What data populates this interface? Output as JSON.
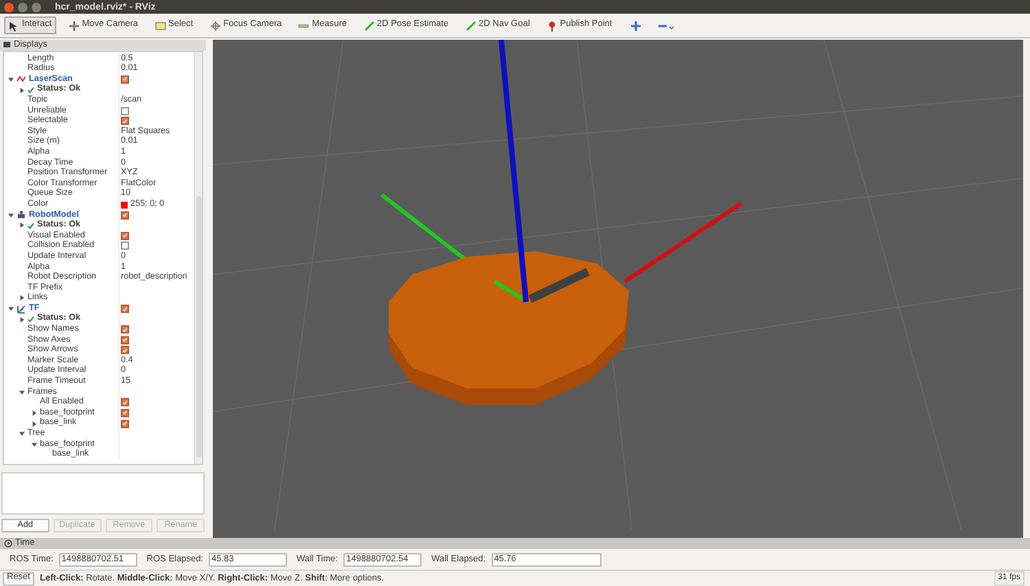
{
  "window": {
    "title": "hcr_model.rviz* - RViz"
  },
  "toolbar": [
    {
      "label": "Interact",
      "selected": true
    },
    {
      "label": "Move Camera",
      "selected": false
    },
    {
      "label": "Select",
      "selected": false
    },
    {
      "label": "Focus Camera",
      "selected": false
    },
    {
      "label": "Measure",
      "selected": false
    },
    {
      "label": "2D Pose Estimate",
      "selected": false
    },
    {
      "label": "2D Nav Goal",
      "selected": false
    },
    {
      "label": "Publish Point",
      "selected": false
    }
  ],
  "displays": {
    "title": "Displays",
    "items": [
      {
        "kind": "property",
        "label": "Length",
        "value": "0.5"
      },
      {
        "kind": "property",
        "label": "Radius",
        "value": "0.01"
      },
      {
        "kind": "display",
        "label": "LaserScan",
        "checked": true,
        "expanded": true,
        "children": [
          {
            "kind": "status",
            "label": "Status: Ok",
            "expanded": false
          },
          {
            "kind": "property",
            "label": "Topic",
            "value": "/scan"
          },
          {
            "kind": "check",
            "label": "Unreliable",
            "checked": false
          },
          {
            "kind": "check",
            "label": "Selectable",
            "checked": true
          },
          {
            "kind": "property",
            "label": "Style",
            "value": "Flat Squares"
          },
          {
            "kind": "property",
            "label": "Size (m)",
            "value": "0.01"
          },
          {
            "kind": "property",
            "label": "Alpha",
            "value": "1"
          },
          {
            "kind": "property",
            "label": "Decay Time",
            "value": "0"
          },
          {
            "kind": "property",
            "label": "Position Transformer",
            "value": "XYZ"
          },
          {
            "kind": "property",
            "label": "Color Transformer",
            "value": "FlatColor"
          },
          {
            "kind": "property",
            "label": "Queue Size",
            "value": "10"
          },
          {
            "kind": "color",
            "label": "Color",
            "value": "255; 0; 0",
            "color": "#ff0000"
          }
        ]
      },
      {
        "kind": "display",
        "label": "RobotModel",
        "checked": true,
        "expanded": true,
        "children": [
          {
            "kind": "status",
            "label": "Status: Ok",
            "expanded": false
          },
          {
            "kind": "check",
            "label": "Visual Enabled",
            "checked": true
          },
          {
            "kind": "check",
            "label": "Collision Enabled",
            "checked": false
          },
          {
            "kind": "property",
            "label": "Update Interval",
            "value": "0"
          },
          {
            "kind": "property",
            "label": "Alpha",
            "value": "1"
          },
          {
            "kind": "property",
            "label": "Robot Description",
            "value": "robot_description"
          },
          {
            "kind": "property",
            "label": "TF Prefix"
          },
          {
            "kind": "group",
            "label": "Links",
            "expanded": false
          }
        ]
      },
      {
        "kind": "display",
        "label": "TF",
        "checked": true,
        "expanded": true,
        "children": [
          {
            "kind": "status",
            "label": "Status: Ok",
            "expanded": false
          },
          {
            "kind": "check",
            "label": "Show Names",
            "checked": true
          },
          {
            "kind": "check",
            "label": "Show Axes",
            "checked": true
          },
          {
            "kind": "check",
            "label": "Show Arrows",
            "checked": true
          },
          {
            "kind": "property",
            "label": "Marker Scale",
            "value": "0.4"
          },
          {
            "kind": "property",
            "label": "Update Interval",
            "value": "0"
          },
          {
            "kind": "property",
            "label": "Frame Timeout",
            "value": "15"
          },
          {
            "kind": "group",
            "label": "Frames",
            "expanded": true,
            "children": [
              {
                "kind": "check",
                "label": "All Enabled",
                "checked": true
              },
              {
                "kind": "check",
                "label": "base_footprint",
                "checked": true,
                "expanded": false
              },
              {
                "kind": "check",
                "label": "base_link",
                "checked": true,
                "expanded": false
              }
            ]
          },
          {
            "kind": "group",
            "label": "Tree",
            "expanded": true,
            "children": [
              {
                "kind": "group",
                "label": "base_footprint",
                "expanded": true,
                "children": [
                  {
                    "kind": "group",
                    "label": "base_link"
                  }
                ]
              }
            ]
          }
        ]
      }
    ],
    "buttons": [
      {
        "label": "Add",
        "disabled": false
      },
      {
        "label": "Duplicate",
        "disabled": true
      },
      {
        "label": "Remove",
        "disabled": true
      },
      {
        "label": "Rename",
        "disabled": true
      }
    ]
  },
  "time": {
    "title": "Time",
    "fields": [
      {
        "label": "ROS Time:",
        "value": "1498880702.51"
      },
      {
        "label": "ROS Elapsed:",
        "value": "45.83"
      },
      {
        "label": "Wall Time:",
        "value": "1498880702.54"
      },
      {
        "label": "Wall Elapsed:",
        "value": "45.76"
      }
    ]
  },
  "status_bar": {
    "reset": "Reset",
    "hint": "**Left-Click:** Rotate. **Middle-Click:** Move X/Y. **Right-Click:** Move Z. **Shift**: More options.",
    "fps": "31 fps"
  }
}
